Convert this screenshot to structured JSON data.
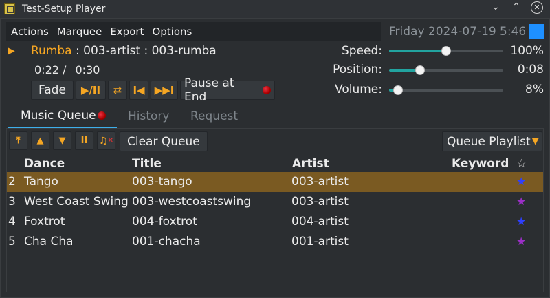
{
  "window": {
    "title": "Test-Setup Player",
    "buttons": {
      "minimize": "⌄",
      "maximize": "⌃",
      "close": "✕"
    }
  },
  "menu": [
    "Actions",
    "Marquee",
    "Export",
    "Options"
  ],
  "clock": {
    "date": "Friday 2024-07-19",
    "time": "5:46",
    "indicator_color": "#1e90ff"
  },
  "now_playing": {
    "dance": "Rumba",
    "sep1": " : ",
    "artist": "003-artist",
    "sep2": " : ",
    "title": "003-rumba",
    "elapsed": "0:22 /",
    "duration": "0:30"
  },
  "controls": {
    "fade": "Fade",
    "play_pause": "▶/II",
    "repeat": "⇄",
    "prev": "I◀",
    "next": "▶▶I",
    "pause_at_end": "Pause at End"
  },
  "sliders": [
    {
      "label": "Speed:",
      "value": "100%",
      "level": 0.5
    },
    {
      "label": "Position:",
      "value": "0:08",
      "level": 0.27
    },
    {
      "label": "Volume:",
      "value": "8%",
      "level": 0.08
    }
  ],
  "tabs": [
    {
      "label": "Music Queue",
      "active": true
    },
    {
      "label": "History",
      "active": false
    },
    {
      "label": "Request",
      "active": false
    }
  ],
  "queue_tools": {
    "clear_label": "Clear Queue",
    "playlist_label": "Queue Playlist"
  },
  "table": {
    "columns": {
      "dance": "Dance",
      "title": "Title",
      "artist": "Artist",
      "keyword": "Keyword",
      "fav": "☆"
    },
    "rows": [
      {
        "num": "2",
        "dance": "Tango",
        "title": "003-tango",
        "artist": "003-artist",
        "keyword": "",
        "star_color": "#2f3fff",
        "selected": true
      },
      {
        "num": "3",
        "dance": "West Coast Swing",
        "title": "003-westcoastswing",
        "artist": "003-artist",
        "keyword": "",
        "star_color": "#9b2fc7",
        "selected": false
      },
      {
        "num": "4",
        "dance": "Foxtrot",
        "title": "004-foxtrot",
        "artist": "004-artist",
        "keyword": "",
        "star_color": "#2f3fff",
        "selected": false
      },
      {
        "num": "5",
        "dance": "Cha Cha",
        "title": "001-chacha",
        "artist": "001-artist",
        "keyword": "",
        "star_color": "#9b2fc7",
        "selected": false
      }
    ]
  },
  "colors": {
    "accent": "#f5a623",
    "highlight_row": "#7a5a22",
    "slider_fill": "#22a4a0",
    "tab_underline": "#3daee9"
  }
}
